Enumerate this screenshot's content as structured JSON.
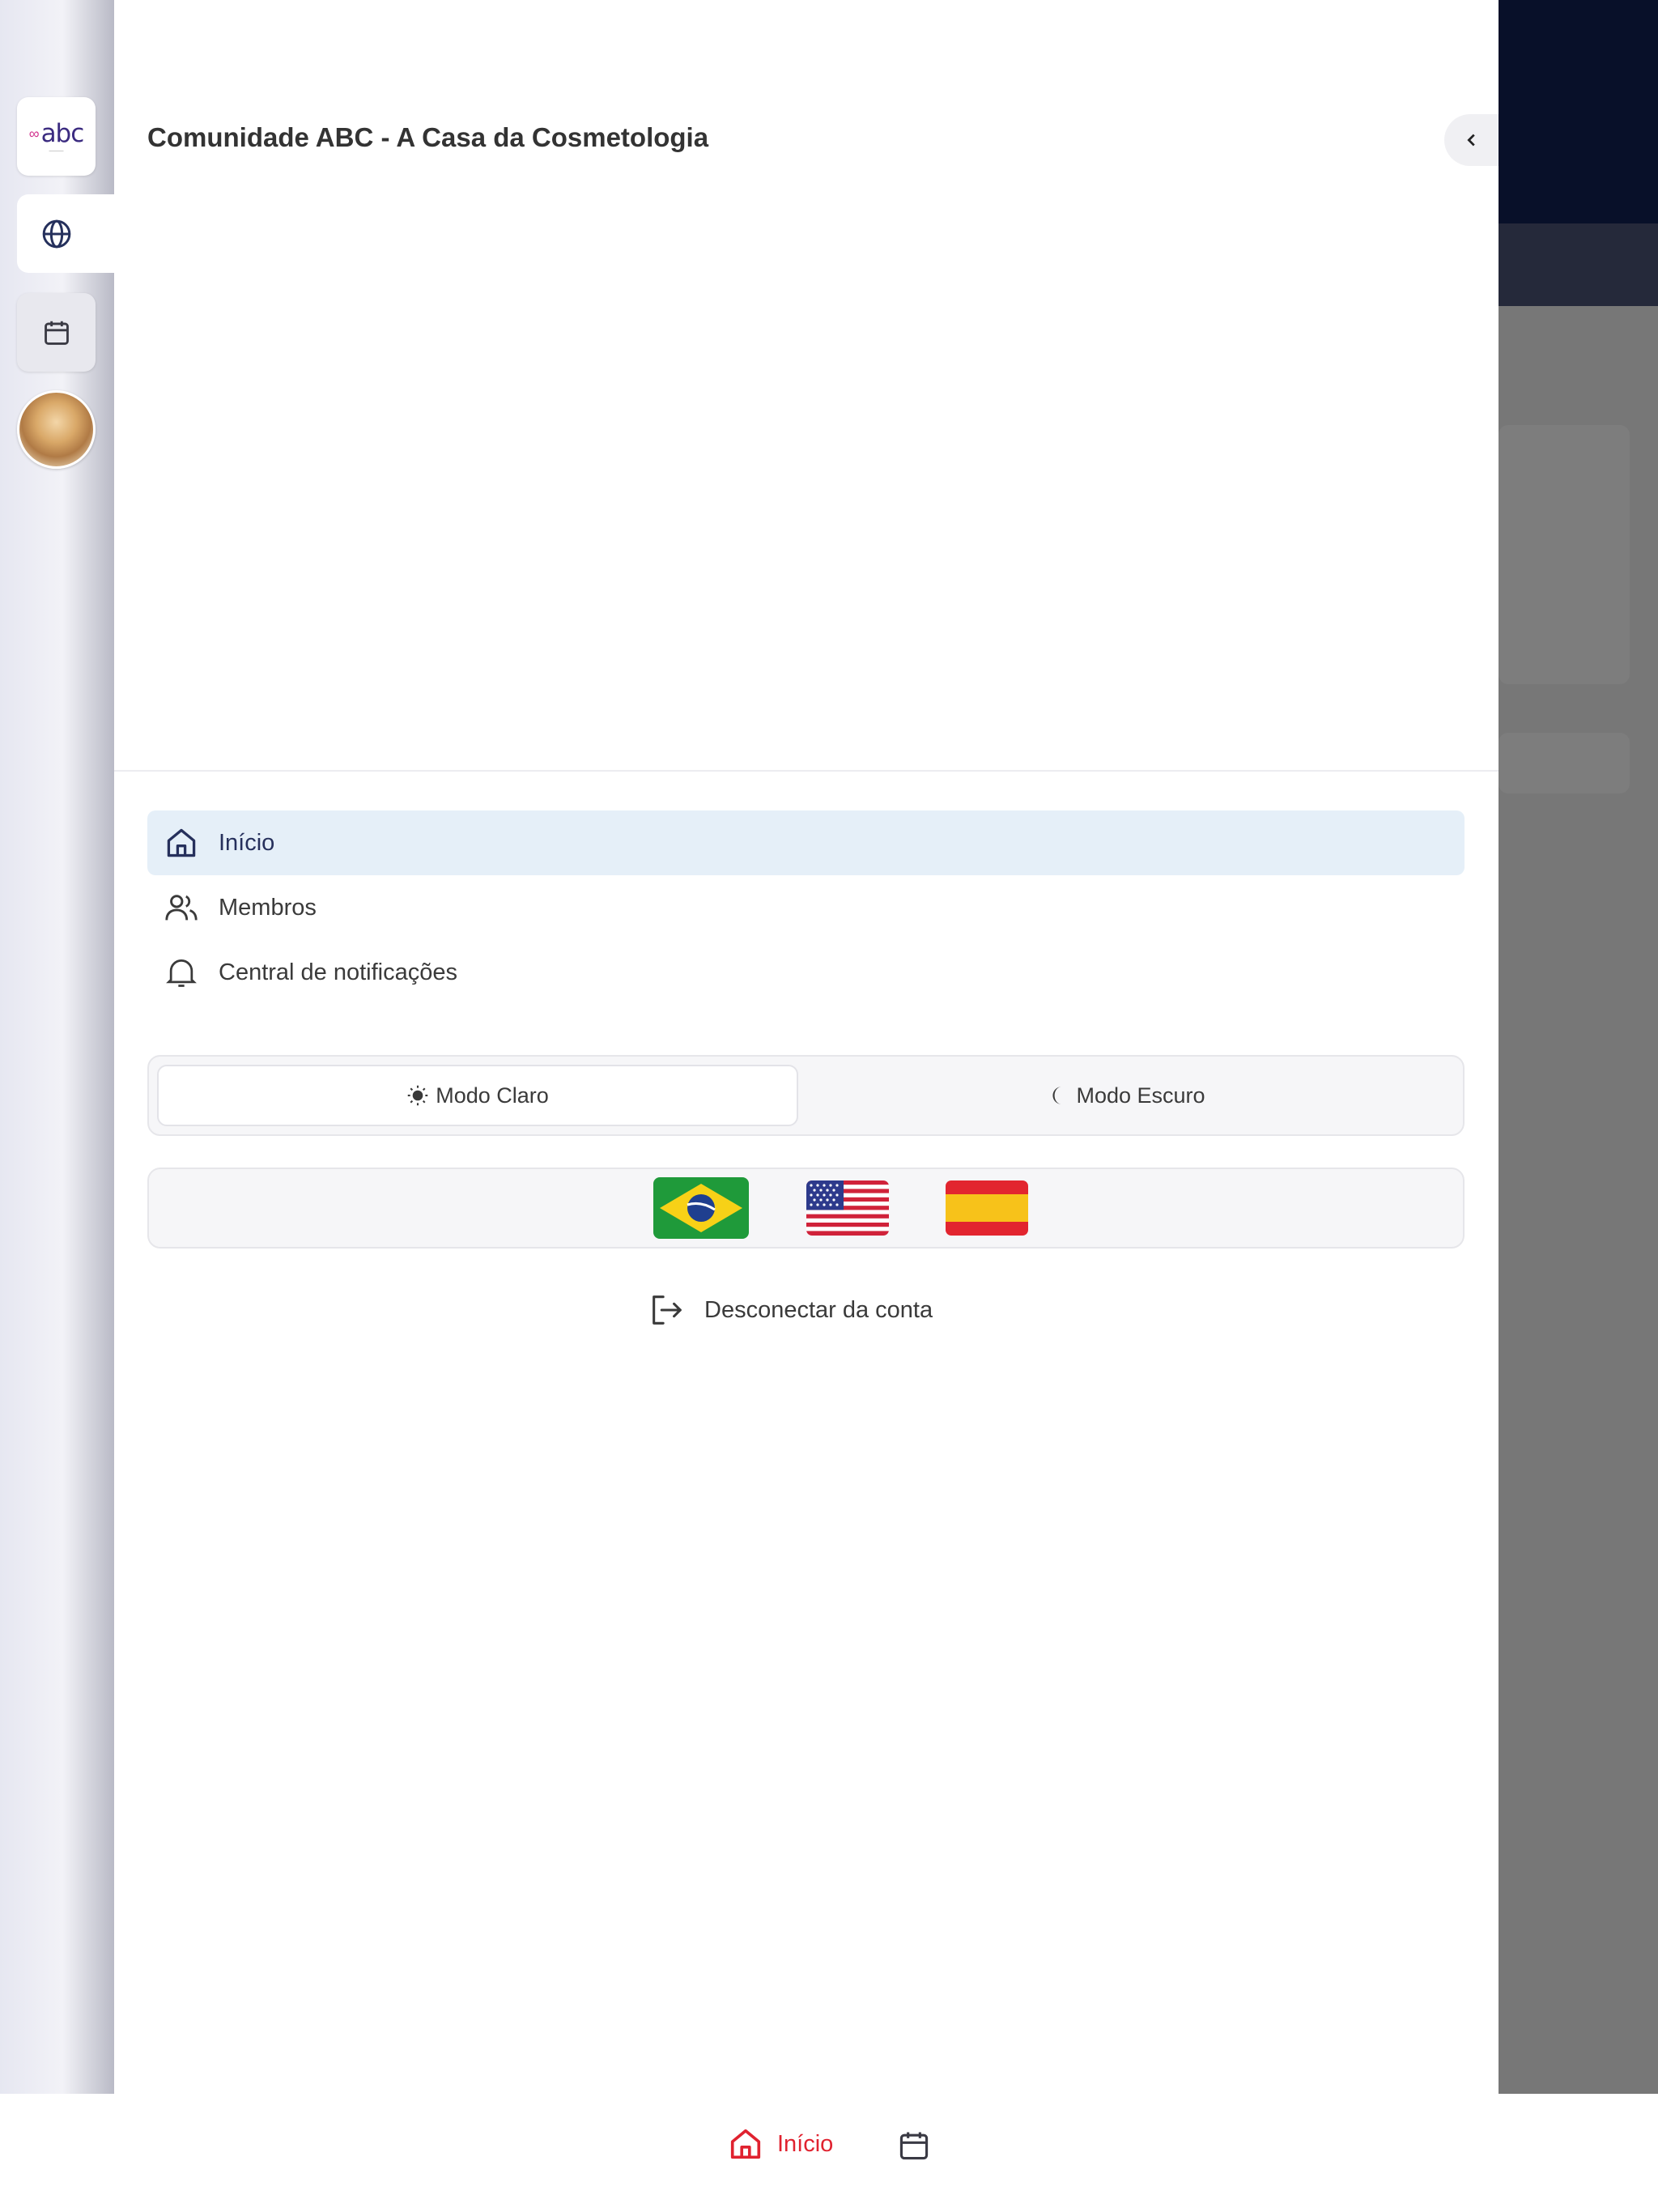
{
  "app": {
    "community_title": "Comunidade ABC - A Casa da Cosmetologia"
  },
  "rail": {
    "logo_text": "abc",
    "items": [
      {
        "icon": "abc-logo",
        "active": false
      },
      {
        "icon": "globe-icon",
        "active": true
      },
      {
        "icon": "calendar-icon",
        "active": false
      },
      {
        "icon": "avatar",
        "active": false
      }
    ]
  },
  "nav": {
    "items": [
      {
        "label": "Início",
        "icon": "home-icon",
        "active": true
      },
      {
        "label": "Membros",
        "icon": "users-icon",
        "active": false
      },
      {
        "label": "Central de notificações",
        "icon": "bell-icon",
        "active": false
      }
    ]
  },
  "theme": {
    "light_label": "Modo Claro",
    "dark_label": "Modo Escuro",
    "selected": "light"
  },
  "languages": [
    {
      "code": "pt-BR",
      "icon": "brazil-flag-icon"
    },
    {
      "code": "en-US",
      "icon": "usa-flag-icon"
    },
    {
      "code": "es",
      "icon": "spain-flag-icon"
    }
  ],
  "logout": {
    "label": "Desconectar da conta"
  },
  "bottom_nav": {
    "home_label": "Início",
    "items": [
      {
        "icon": "home-icon",
        "active": true
      },
      {
        "icon": "calendar-icon",
        "active": false
      }
    ]
  },
  "colors": {
    "active_nav_bg": "#e5eff8",
    "active_nav_text": "#26305c",
    "bottom_active": "#e0222f",
    "header_dark": "#081029"
  }
}
